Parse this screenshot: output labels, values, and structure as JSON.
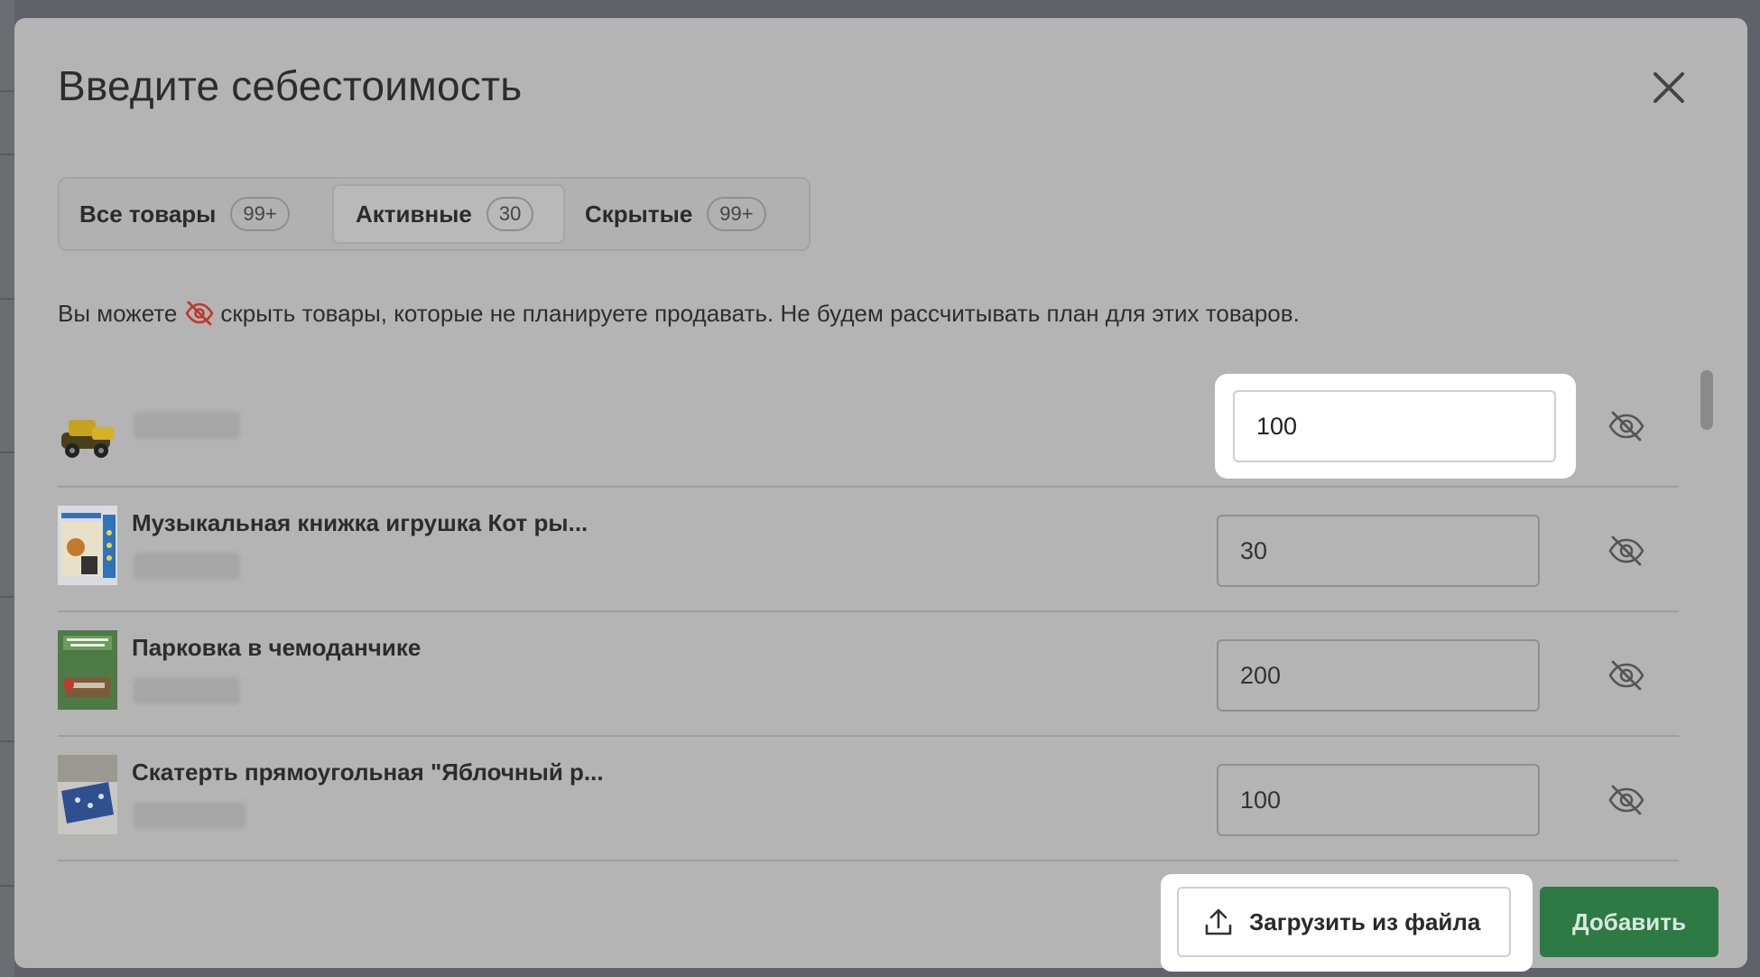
{
  "modal": {
    "title": "Введите себестоимость",
    "close_icon": "close-icon"
  },
  "tabs": [
    {
      "label": "Все товары",
      "badge": "99+",
      "active": false
    },
    {
      "label": "Активные",
      "badge": "30",
      "active": true
    },
    {
      "label": "Скрытые",
      "badge": "99+",
      "active": false
    }
  ],
  "info": {
    "before": "Вы можете",
    "icon": "eye-off-icon",
    "after": "скрыть товары, которые не планируете продавать. Не будем рассчитывать план для этих товаров."
  },
  "products": [
    {
      "name": "",
      "cost": "100",
      "thumb": "toy-excavator",
      "hide_icon": "eye-off-icon"
    },
    {
      "name": "Музыкальная книжка игрушка Кот ры...",
      "cost": "30",
      "thumb": "music-book",
      "hide_icon": "eye-off-icon"
    },
    {
      "name": "Парковка в чемоданчике",
      "cost": "200",
      "thumb": "parking-case",
      "hide_icon": "eye-off-icon"
    },
    {
      "name": "Скатерть прямоугольная \"Яблочный р...",
      "cost": "100",
      "thumb": "tablecloth",
      "hide_icon": "eye-off-icon"
    }
  ],
  "footer": {
    "upload_label": "Загрузить из файла",
    "upload_icon": "upload-icon",
    "add_label": "Добавить"
  },
  "colors": {
    "overlay": "#5f6268",
    "modal_bg": "#b4b4b4",
    "accent_green": "#2d7a44",
    "hide_icon_red": "#c0392b"
  }
}
